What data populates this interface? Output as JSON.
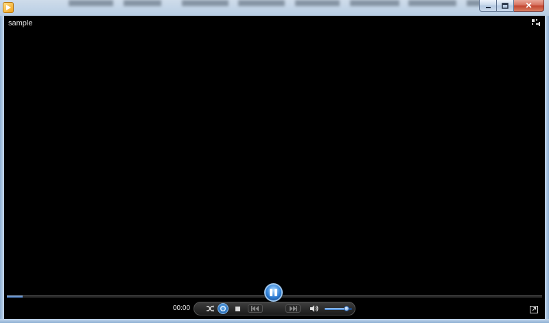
{
  "window": {
    "app_icon": "windows-media-player-icon",
    "caption": {
      "minimize_icon": "minimize-icon",
      "maximize_icon": "maximize-icon",
      "close_icon": "close-icon",
      "close_glyph": "✕"
    }
  },
  "player": {
    "media_title": "sample",
    "switch_to_library_icon": "switch-to-library-icon",
    "elapsed_time": "00:00",
    "seek_progress": 0.03,
    "volume_level": 0.8,
    "fullscreen_icon": "fullscreen-icon",
    "controls": {
      "shuffle_icon": "shuffle-icon",
      "repeat_icon": "repeat-icon",
      "stop_icon": "stop-icon",
      "previous_icon": "previous-icon",
      "play_pause_icon": "pause-icon",
      "next_icon": "next-icon",
      "mute_icon": "speaker-icon"
    }
  },
  "colors": {
    "video_bg": "#000000",
    "accent": "#2e7fd6",
    "frame": "#aac3dd"
  }
}
